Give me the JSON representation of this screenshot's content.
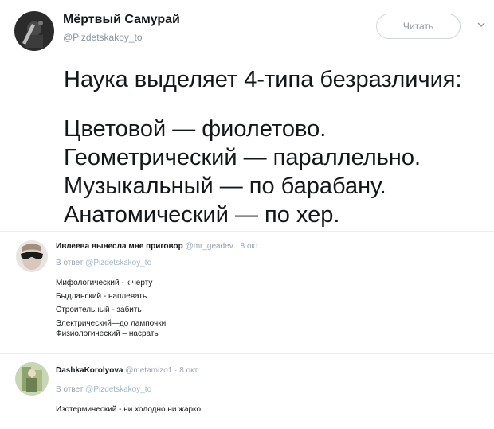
{
  "tweet": {
    "author_name": "Мёртвый Самурай",
    "author_handle": "@Pizdetskakoy_to",
    "follow_label": "Читать",
    "caret_icon": "chevron-down-icon",
    "lines": [
      "Наука выделяет 4-типа безразличия:",
      "Цветовой — фиолетово.",
      "Геометрический — параллельно.",
      "Музыкальный — по барабану.",
      "Анатомический — по хер."
    ]
  },
  "replies": [
    {
      "author_name": "Ивлеева вынесла мне приговор",
      "meta": "@mr_geadev · 8 окт.",
      "reply_prefix": "В ответ",
      "reply_handle": "@Pizdetskakoy_to",
      "lines": [
        "Мифологический - к черту",
        "Быдланский - наплевать",
        "Строительный - забить",
        "Электрический—до лампочки",
        "Физиологический – насрать"
      ]
    },
    {
      "author_name": "DashkaKorolyova",
      "meta": "@metamizo1 · 8 окт.",
      "reply_prefix": "В ответ",
      "reply_handle": "@Pizdetskakoy_to",
      "lines": [
        "Изотермический - ни холодно ни жарко"
      ]
    }
  ]
}
